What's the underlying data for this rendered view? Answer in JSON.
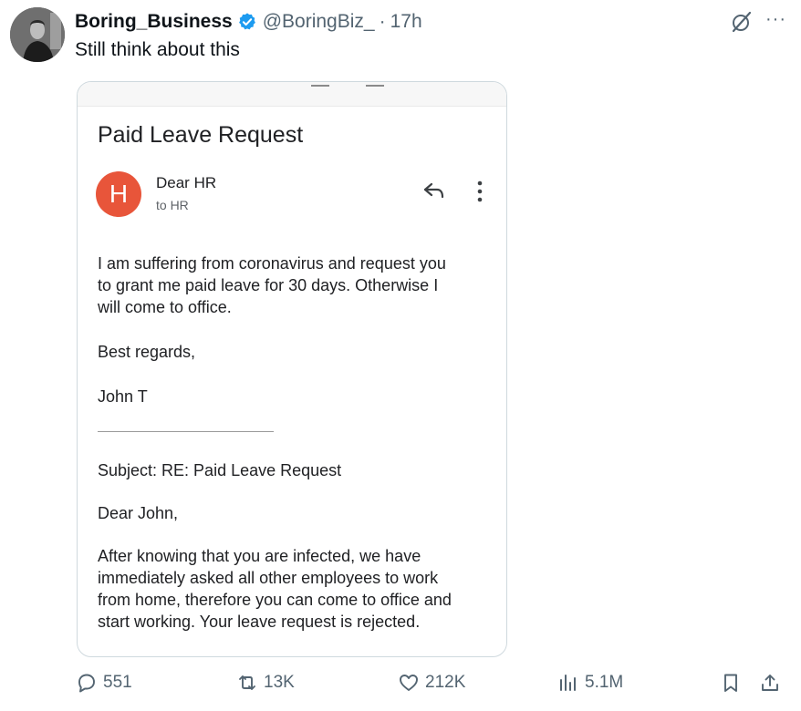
{
  "post": {
    "author": {
      "display_name": "Boring_Business",
      "handle": "@BoringBiz_",
      "separator": "·",
      "time": "17h"
    },
    "text": "Still think about this",
    "icons": [
      "verified-badge-icon",
      "grok-icon",
      "more-icon"
    ],
    "colors": {
      "verified": "#1d9bf0",
      "secondary_text": "#536471"
    }
  },
  "email": {
    "subject": "Paid Leave Request",
    "sender_initial": "H",
    "sender_name": "Dear HR",
    "recipient": "to HR",
    "avatar_color": "#e8553a",
    "body_lines": [
      "I am suffering from coronavirus and request you",
      "to grant me paid leave for 30 days. Otherwise I",
      "will come to office."
    ],
    "regards": "Best regards,",
    "signature": "John T",
    "reply_subject": "Subject: RE: Paid Leave Request",
    "reply_greeting": "Dear John,",
    "reply_lines": [
      "After knowing that you are infected, we have",
      "immediately asked all other employees to work",
      "from home, therefore you can come to office and",
      "start working. Your leave request is rejected."
    ]
  },
  "engagement": {
    "replies": "551",
    "reposts": "13K",
    "likes": "212K",
    "views": "5.1M"
  }
}
